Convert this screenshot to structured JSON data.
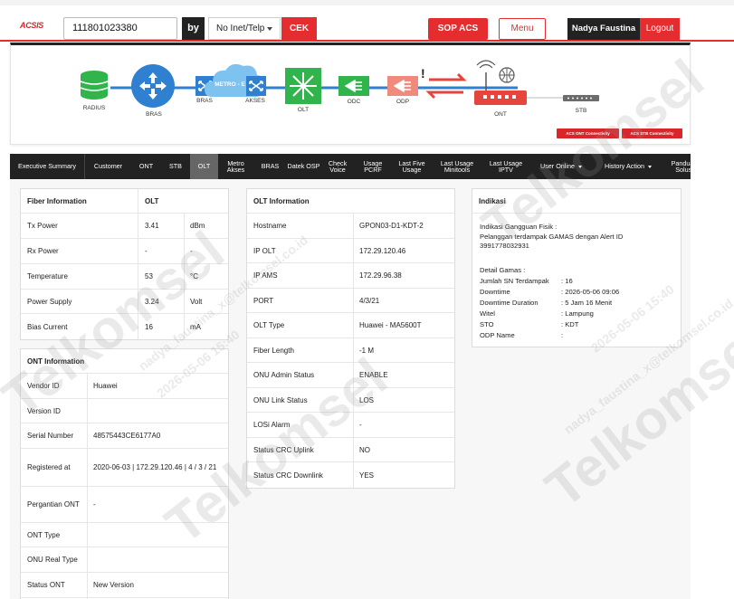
{
  "header": {
    "logo": "ACSIS",
    "search_value": "111801023380",
    "by_label": "by",
    "search_type": "No Inet/Telp",
    "check_label": "CEK",
    "sop_label": "SOP ACS",
    "menu_label": "Menu",
    "user_name": "Nadya Faustina",
    "logout_label": "Logout"
  },
  "topology": {
    "nodes": [
      "RADIUS",
      "BRAS",
      "BRAS",
      "METRO - E",
      "AKSES",
      "OLT",
      "ODC",
      "ODP",
      "ONT",
      "STB"
    ],
    "status_marker": "!",
    "buttons": [
      "ACS ONT Connectivity",
      "ACS STB Connectivity"
    ],
    "colors": {
      "blue": "#2f80d1",
      "green": "#31b44b",
      "red": "#e5453d",
      "gray": "#6c6c6c",
      "cloud": "#7ec2f0"
    }
  },
  "tabs": [
    {
      "label": "Executive Summary"
    },
    {
      "label": "Customer"
    },
    {
      "label": "ONT"
    },
    {
      "label": "STB"
    },
    {
      "label": "OLT",
      "active": true
    },
    {
      "label": "Metro Akses"
    },
    {
      "label": "BRAS"
    },
    {
      "label": "Datek OSP"
    },
    {
      "label": "Check Voice"
    },
    {
      "label": "Usage PCRF"
    },
    {
      "label": "Last Five Usage"
    },
    {
      "label": "Last Usage Minitools"
    },
    {
      "label": "Last Usage IPTV"
    },
    {
      "label": "User Online",
      "dropdown": true
    },
    {
      "label": "History Action",
      "dropdown": true
    },
    {
      "label": "Panduan Solusi"
    }
  ],
  "fiber": {
    "title": "Fiber Information",
    "col_title": "OLT",
    "rows": [
      {
        "name": "Tx Power",
        "value": "3.41",
        "unit": "dBm"
      },
      {
        "name": "Rx Power",
        "value": "-",
        "unit": "-"
      },
      {
        "name": "Temperature",
        "value": "53",
        "unit": "°C"
      },
      {
        "name": "Power Supply",
        "value": "3.24",
        "unit": "Volt"
      },
      {
        "name": "Bias Current",
        "value": "16",
        "unit": "mA"
      }
    ]
  },
  "ont_info": {
    "title": "ONT Information",
    "rows": [
      {
        "name": "Vendor ID",
        "value": "Huawei"
      },
      {
        "name": "Version ID",
        "value": ""
      },
      {
        "name": "Serial Number",
        "value": "48575443CE6177A0"
      },
      {
        "name": "Registered at",
        "value": "2020-06-03 | 172.29.120.46 | 4 / 3 / 21"
      },
      {
        "name": "Pergantian ONT",
        "value": "-"
      },
      {
        "name": "ONT Type",
        "value": ""
      },
      {
        "name": "ONU Real Type",
        "value": ""
      },
      {
        "name": "Status ONT",
        "value": "New Version"
      }
    ]
  },
  "olt_info": {
    "title": "OLT Information",
    "rows": [
      {
        "name": "Hostname",
        "value": "GPON03-D1-KDT-2"
      },
      {
        "name": "IP OLT",
        "value": "172.29.120.46"
      },
      {
        "name": "IP AMS",
        "value": "172.29.96.38"
      },
      {
        "name": "PORT",
        "value": "4/3/21"
      },
      {
        "name": "OLT Type",
        "value": "Huawei - MA5600T"
      },
      {
        "name": "Fiber Length",
        "value": "-1 M"
      },
      {
        "name": "ONU Admin Status",
        "value": "ENABLE"
      },
      {
        "name": "ONU Link Status",
        "value": "LOS"
      },
      {
        "name": "LOSi Alarm",
        "value": "-"
      },
      {
        "name": "Status CRC Uplink",
        "value": "NO"
      },
      {
        "name": "Status CRC Downlink",
        "value": "YES"
      }
    ]
  },
  "indikasi": {
    "title": "Indikasi",
    "heading": "Indikasi Gangguan Fisik :",
    "message_line1": "Pelanggan terdampak GAMAS dengan Alert ID",
    "message_line2": "3991778032931",
    "detail_heading": "Detail Gamas :",
    "details": [
      {
        "name": "Jumlah SN Terdampak",
        "value": ": 16"
      },
      {
        "name": "Downtime",
        "value": ": 2026-05-06 09:06"
      },
      {
        "name": "Downtime Duration",
        "value": ": 5 Jam 16 Menit"
      },
      {
        "name": "Witel",
        "value": ": Lampung"
      },
      {
        "name": "STO",
        "value": ": KDT"
      },
      {
        "name": "ODP Name",
        "value": ":"
      }
    ]
  },
  "watermark": {
    "brand": "Telkomsel",
    "user": "nadya_faustina_x@telkomsel.co.id",
    "date": "2026-05-06 15:40"
  }
}
